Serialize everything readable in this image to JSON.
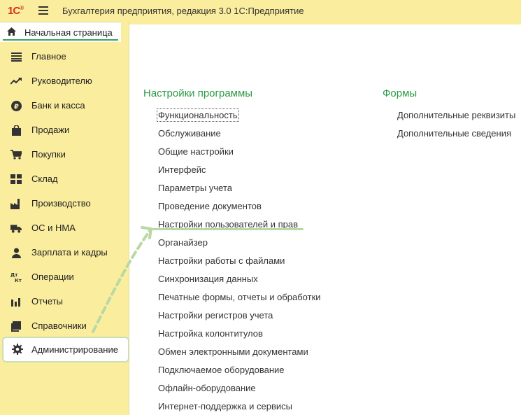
{
  "window": {
    "logo_text": "1С",
    "title": "Бухгалтерия предприятия, редакция 3.0 1С:Предприятие"
  },
  "home_tab": {
    "label": "Начальная страница"
  },
  "sidebar": {
    "items": [
      {
        "label": "Главное",
        "icon": "menu-list-icon"
      },
      {
        "label": "Руководителю",
        "icon": "trend-up-icon"
      },
      {
        "label": "Банк и касса",
        "icon": "ruble-coin-icon"
      },
      {
        "label": "Продажи",
        "icon": "shopping-bag-icon"
      },
      {
        "label": "Покупки",
        "icon": "shopping-cart-icon"
      },
      {
        "label": "Склад",
        "icon": "warehouse-grid-icon"
      },
      {
        "label": "Производство",
        "icon": "factory-icon"
      },
      {
        "label": "ОС и НМА",
        "icon": "truck-icon"
      },
      {
        "label": "Зарплата и кадры",
        "icon": "person-icon"
      },
      {
        "label": "Операции",
        "icon": "debit-credit-icon"
      },
      {
        "label": "Отчеты",
        "icon": "bar-chart-icon"
      },
      {
        "label": "Справочники",
        "icon": "books-icon"
      },
      {
        "label": "Администрирование",
        "icon": "gear-icon"
      }
    ],
    "active_index": 12
  },
  "content": {
    "section_settings": {
      "title": "Настройки программы",
      "links": [
        "Функциональность",
        "Обслуживание",
        "Общие настройки",
        "Интерфейс",
        "Параметры учета",
        "Проведение документов",
        "Настройки пользователей и прав",
        "Органайзер",
        "Настройки работы с файлами",
        "Синхронизация данных",
        "Печатные формы, отчеты и обработки",
        "Настройки регистров учета",
        "Настройка колонтитулов",
        "Обмен электронными документами",
        "Подключаемое оборудование",
        "Офлайн-оборудование",
        "Интернет-поддержка и сервисы"
      ]
    },
    "section_forms": {
      "title": "Формы",
      "links": [
        "Дополнительные реквизиты",
        "Дополнительные сведения"
      ]
    }
  },
  "colors": {
    "sidebar_bg": "#fbed9e",
    "section_title": "#2c9a45",
    "highlight": "#b9d9a4",
    "logo": "#d5331b"
  }
}
